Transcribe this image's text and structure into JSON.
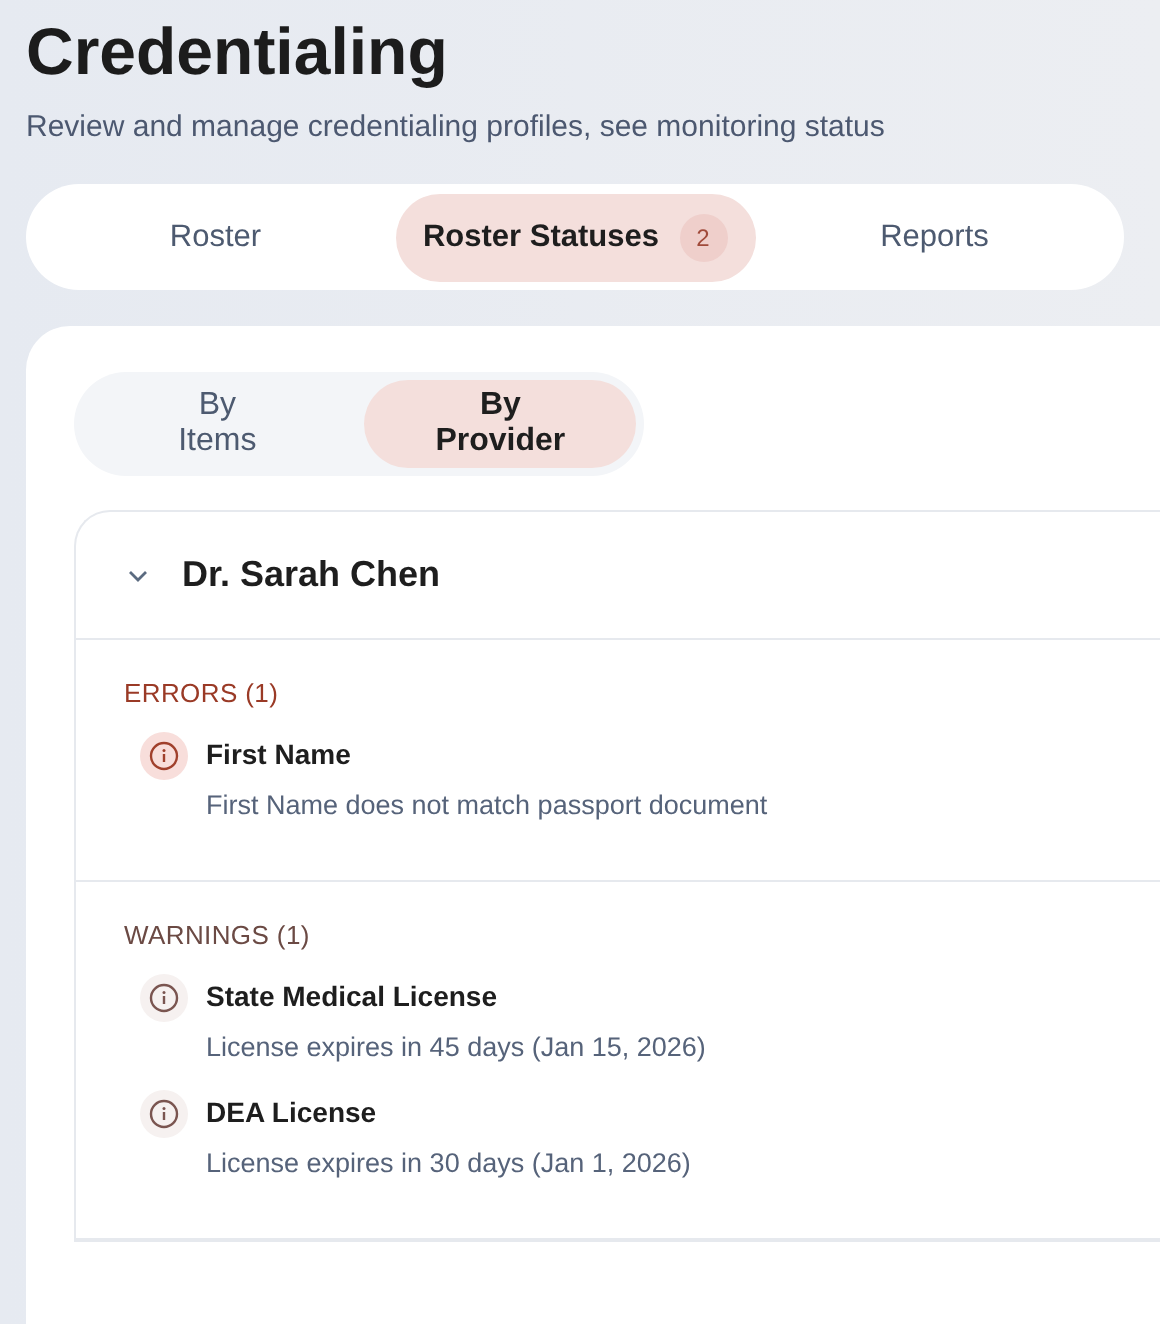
{
  "header": {
    "title": "Credentialing",
    "subtitle": "Review and manage credentialing profiles, see monitoring status"
  },
  "tabs": [
    {
      "label": "Roster",
      "selected": false
    },
    {
      "label": "Roster Statuses",
      "selected": true,
      "badge": "2"
    },
    {
      "label": "Reports",
      "selected": false
    }
  ],
  "view_toggle": [
    {
      "label": "By Items",
      "selected": false
    },
    {
      "label": "By Provider",
      "selected": true
    }
  ],
  "provider": {
    "name": "Dr. Sarah Chen",
    "expanded": true,
    "sections": [
      {
        "kind": "error",
        "heading": "ERRORS (1)",
        "items": [
          {
            "title": "First Name",
            "detail": "First Name does not match passport document"
          }
        ]
      },
      {
        "kind": "warning",
        "heading": "WARNINGS (1)",
        "items": [
          {
            "title": "State Medical License",
            "detail": "License expires in 45 days (Jan 15, 2026)"
          },
          {
            "title": "DEA License",
            "detail": "License expires in 30 days (Jan 1, 2026)"
          }
        ]
      }
    ]
  }
}
